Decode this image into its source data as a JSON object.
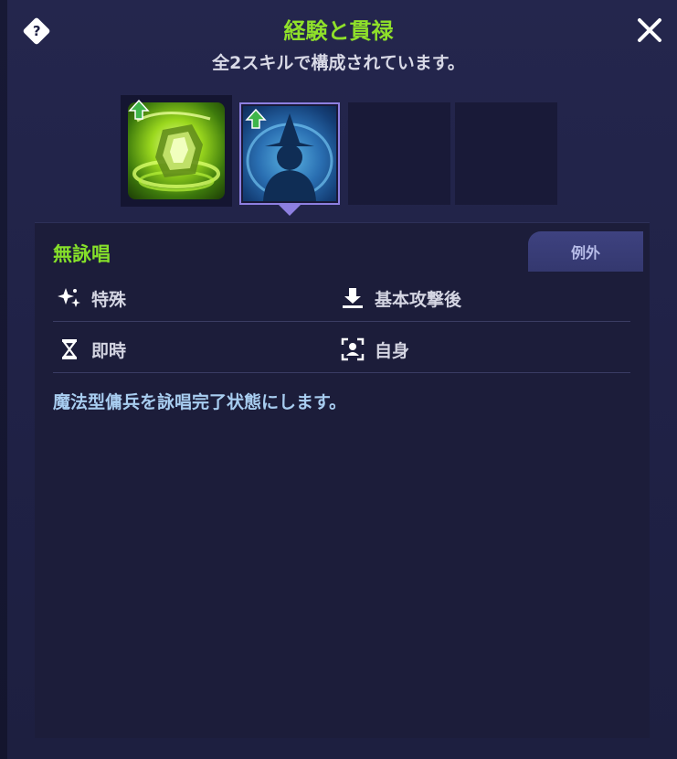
{
  "header": {
    "title": "経験と貫禄",
    "subtitle": "全2スキルで構成されています。",
    "help_icon": "question-diamond-icon",
    "close_icon": "close-icon"
  },
  "skills": {
    "slot1": {
      "icon": "green-warrior-skill-icon",
      "upgrade": true
    },
    "slot2": {
      "icon": "blue-wizard-silhouette-skill-icon",
      "upgrade": true,
      "selected": true
    },
    "slot3": {
      "empty": true
    },
    "slot4": {
      "empty": true
    }
  },
  "detail": {
    "name": "無詠唱",
    "tag": "例外",
    "attributes": {
      "type": {
        "icon": "sparkle-icon",
        "label": "特殊"
      },
      "timing": {
        "icon": "download-icon",
        "label": "基本攻撃後"
      },
      "duration": {
        "icon": "hourglass-icon",
        "label": "即時"
      },
      "target": {
        "icon": "target-person-icon",
        "label": "自身"
      }
    },
    "description": "魔法型傭兵を詠唱完了状態にします。"
  },
  "colors": {
    "accent_green": "#86e02a",
    "description_blue": "#a8cdf0",
    "selected_border": "#8d7fe0",
    "panel_bg": "#1f2145"
  }
}
